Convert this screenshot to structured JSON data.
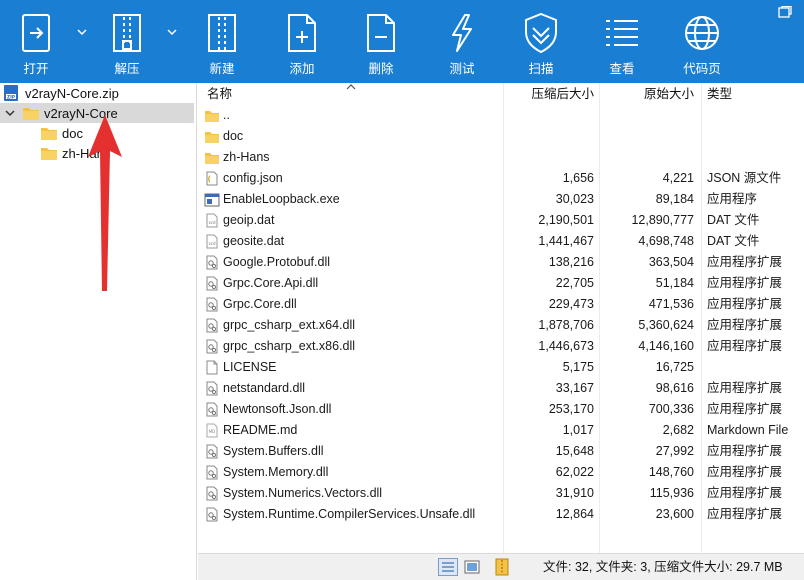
{
  "toolbar": {
    "open": "打开",
    "extract": "解压",
    "new": "新建",
    "add": "添加",
    "delete": "删除",
    "test": "测试",
    "scan": "扫描",
    "view": "查看",
    "codepage": "代码页"
  },
  "tree": {
    "archive": "v2rayN-Core.zip",
    "root": "v2rayN-Core",
    "children": [
      "doc",
      "zh-Hans"
    ]
  },
  "columns": {
    "name": "名称",
    "compressed": "压缩后大小",
    "original": "原始大小",
    "type": "类型"
  },
  "files": [
    {
      "name": "..",
      "comp": "",
      "orig": "",
      "type": "",
      "icon": "folder-icon"
    },
    {
      "name": "doc",
      "comp": "",
      "orig": "",
      "type": "",
      "icon": "folder-icon"
    },
    {
      "name": "zh-Hans",
      "comp": "",
      "orig": "",
      "type": "",
      "icon": "folder-icon"
    },
    {
      "name": "config.json",
      "comp": "1,656",
      "orig": "4,221",
      "type": "JSON 源文件",
      "icon": "json-file-icon"
    },
    {
      "name": "EnableLoopback.exe",
      "comp": "30,023",
      "orig": "89,184",
      "type": "应用程序",
      "icon": "exe-file-icon"
    },
    {
      "name": "geoip.dat",
      "comp": "2,190,501",
      "orig": "12,890,777",
      "type": "DAT 文件",
      "icon": "dat-file-icon"
    },
    {
      "name": "geosite.dat",
      "comp": "1,441,467",
      "orig": "4,698,748",
      "type": "DAT 文件",
      "icon": "dat-file-icon"
    },
    {
      "name": "Google.Protobuf.dll",
      "comp": "138,216",
      "orig": "363,504",
      "type": "应用程序扩展",
      "icon": "dll-file-icon"
    },
    {
      "name": "Grpc.Core.Api.dll",
      "comp": "22,705",
      "orig": "51,184",
      "type": "应用程序扩展",
      "icon": "dll-file-icon"
    },
    {
      "name": "Grpc.Core.dll",
      "comp": "229,473",
      "orig": "471,536",
      "type": "应用程序扩展",
      "icon": "dll-file-icon"
    },
    {
      "name": "grpc_csharp_ext.x64.dll",
      "comp": "1,878,706",
      "orig": "5,360,624",
      "type": "应用程序扩展",
      "icon": "dll-file-icon"
    },
    {
      "name": "grpc_csharp_ext.x86.dll",
      "comp": "1,446,673",
      "orig": "4,146,160",
      "type": "应用程序扩展",
      "icon": "dll-file-icon"
    },
    {
      "name": "LICENSE",
      "comp": "5,175",
      "orig": "16,725",
      "type": "",
      "icon": "blank-file-icon"
    },
    {
      "name": "netstandard.dll",
      "comp": "33,167",
      "orig": "98,616",
      "type": "应用程序扩展",
      "icon": "dll-file-icon"
    },
    {
      "name": "Newtonsoft.Json.dll",
      "comp": "253,170",
      "orig": "700,336",
      "type": "应用程序扩展",
      "icon": "dll-file-icon"
    },
    {
      "name": "README.md",
      "comp": "1,017",
      "orig": "2,682",
      "type": "Markdown File",
      "icon": "md-file-icon"
    },
    {
      "name": "System.Buffers.dll",
      "comp": "15,648",
      "orig": "27,992",
      "type": "应用程序扩展",
      "icon": "dll-file-icon"
    },
    {
      "name": "System.Memory.dll",
      "comp": "62,022",
      "orig": "148,760",
      "type": "应用程序扩展",
      "icon": "dll-file-icon"
    },
    {
      "name": "System.Numerics.Vectors.dll",
      "comp": "31,910",
      "orig": "115,936",
      "type": "应用程序扩展",
      "icon": "dll-file-icon"
    },
    {
      "name": "System.Runtime.CompilerServices.Unsafe.dll",
      "comp": "12,864",
      "orig": "23,600",
      "type": "应用程序扩展",
      "icon": "dll-file-icon"
    }
  ],
  "status": {
    "text": "文件: 32, 文件夹: 3, 压缩文件大小: 29.7 MB"
  },
  "colors": {
    "toolbar": "#1a7fd3",
    "selection": "#d9d9d9",
    "arrow": "#e53030",
    "folder": "#f5c244"
  }
}
